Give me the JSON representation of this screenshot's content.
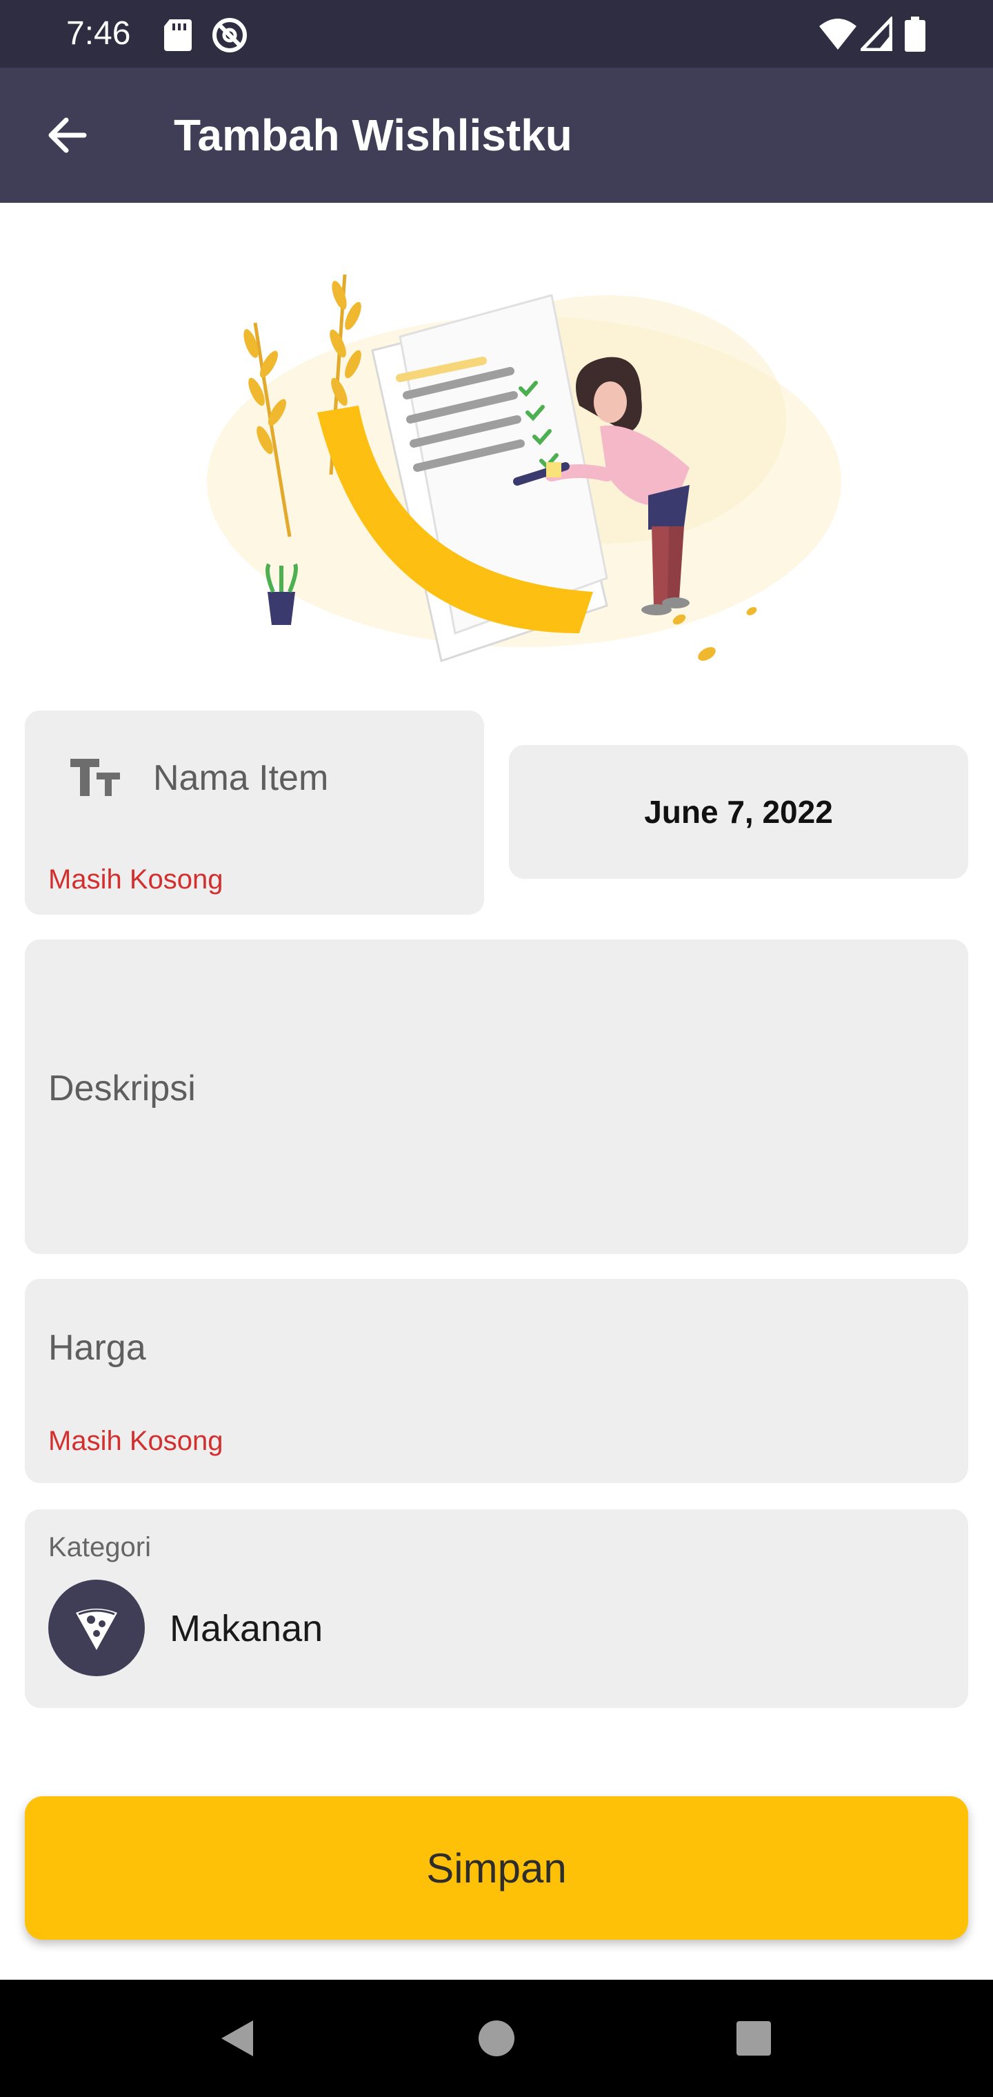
{
  "status_bar": {
    "time": "7:46",
    "icons": [
      "sd-card-icon",
      "do-not-disturb-icon",
      "wifi-icon",
      "signal-icon",
      "battery-icon"
    ]
  },
  "app_bar": {
    "title": "Tambah Wishlistku",
    "back_icon": "arrow-left-icon"
  },
  "form": {
    "nama_item": {
      "placeholder": "Nama Item",
      "icon": "text-size-icon",
      "error": "Masih Kosong"
    },
    "tanggal": {
      "value": "June 7, 2022"
    },
    "deskripsi": {
      "placeholder": "Deskripsi"
    },
    "harga": {
      "placeholder": "Harga",
      "error": "Masih Kosong"
    },
    "kategori": {
      "label": "Kategori",
      "value": "Makanan",
      "icon": "pizza-icon"
    }
  },
  "save_button": {
    "label": "Simpan"
  },
  "colors": {
    "status_bar": "#2e2d42",
    "app_bar": "#403e56",
    "accent": "#ffc107",
    "error": "#d32f2f",
    "field_bg": "#eeeeee"
  },
  "nav_bar": {
    "icons": [
      "back-triangle-icon",
      "home-circle-icon",
      "recents-square-icon"
    ]
  }
}
